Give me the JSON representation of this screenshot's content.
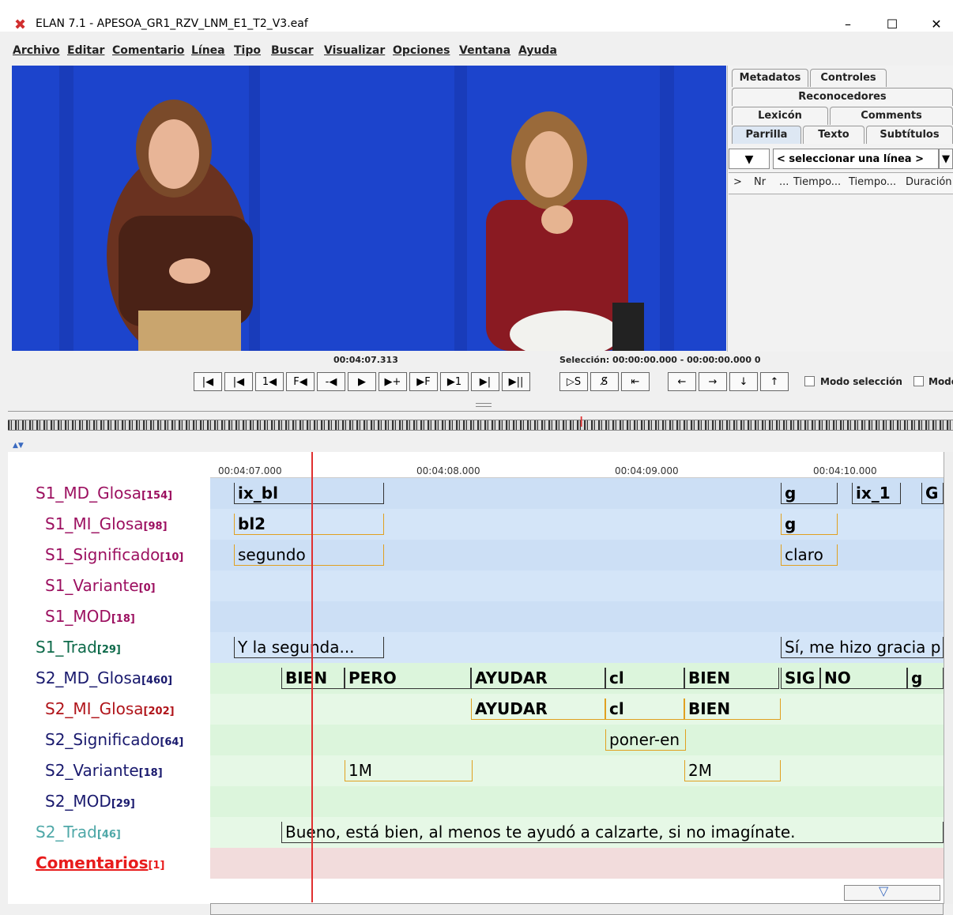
{
  "window": {
    "title": "ELAN 7.1 - APESOA_GR1_RZV_LNM_E1_T2_V3.eaf",
    "icon": "elan-logo-icon",
    "controls": [
      "–",
      "☐",
      "✕"
    ]
  },
  "menu": [
    "Archivo",
    "Editar",
    "Comentario",
    "Línea",
    "Tipo",
    "Buscar",
    "Visualizar",
    "Opciones",
    "Ventana",
    "Ayuda"
  ],
  "right_panel": {
    "tabs_row1": [
      "Metadatos",
      "Controles"
    ],
    "tabs_row2": [
      "Reconocedores"
    ],
    "tabs_row3": [
      "Lexicón",
      "Comments"
    ],
    "tabs_row4": [
      "Parrilla",
      "Texto",
      "Subtítulos"
    ],
    "selected_tab": "Parrilla",
    "tier_select_placeholder": "< seleccionar una línea >",
    "grid_columns": [
      ">",
      "Nr",
      "...",
      "Tiempo...",
      "Tiempo...",
      "Duración"
    ]
  },
  "player": {
    "current_time": "00:04:07.313",
    "selection": "Selección: 00:00:00.000 - 00:00:00.000  0",
    "buttons": [
      "|◀",
      "|◀",
      "1◀",
      "F◀",
      "-◀",
      "▶",
      "▶+",
      "▶F",
      "▶1",
      "▶|",
      "▶||"
    ],
    "sel_buttons": [
      "▷S",
      "S̸",
      "⇤"
    ],
    "nav_buttons": [
      "←",
      "→",
      "↓",
      "↑"
    ],
    "mode_selection_label": "Modo selección",
    "mode_other_label": "Modo"
  },
  "timeline": {
    "ruler_labels": [
      "00:04:07.000",
      "00:04:08.000",
      "00:04:09.000",
      "00:04:10.000"
    ],
    "tiers": [
      {
        "name": "S1_MD_Glosa",
        "count": "[154]",
        "color": "#9c1060"
      },
      {
        "name": "S1_MI_Glosa",
        "count": "[98]",
        "color": "#9c1060"
      },
      {
        "name": "S1_Significado",
        "count": "[10]",
        "color": "#9c1060"
      },
      {
        "name": "S1_Variante",
        "count": "[0]",
        "color": "#9c1060"
      },
      {
        "name": "S1_MOD",
        "count": "[18]",
        "color": "#9c1060"
      },
      {
        "name": "S1_Trad",
        "count": "[29]",
        "color": "#0e6a4a"
      },
      {
        "name": "S2_MD_Glosa",
        "count": "[460]",
        "color": "#1a1a6e"
      },
      {
        "name": "S2_MI_Glosa",
        "count": "[202]",
        "color": "#b0141a"
      },
      {
        "name": "S2_Significado",
        "count": "[64]",
        "color": "#1a1a6e"
      },
      {
        "name": "S2_Variante",
        "count": "[18]",
        "color": "#1a1a6e"
      },
      {
        "name": "S2_MOD",
        "count": "[29]",
        "color": "#1a1a6e"
      },
      {
        "name": "S2_Trad",
        "count": "[46]",
        "color": "#4fa8a8"
      },
      {
        "name": "Comentarios",
        "count": "[1]",
        "color": "#e81c1c"
      }
    ],
    "annotations": {
      "s1_md": [
        "ix_bl",
        "g",
        "ix_1",
        "G"
      ],
      "s1_mi": [
        "bl2",
        "g"
      ],
      "s1_sig": [
        "segundo",
        "claro"
      ],
      "s1_trad": [
        "Y la segunda...",
        "Sí, me hizo gracia p"
      ],
      "s2_md": [
        "BIEN",
        "PERO",
        "AYUDAR",
        "cl",
        "BIEN",
        "SIG",
        "NO",
        "g"
      ],
      "s2_mi": [
        "AYUDAR",
        "cl",
        "BIEN"
      ],
      "s2_sig": [
        "poner-en"
      ],
      "s2_var": [
        "1M",
        "2M"
      ],
      "s2_trad": [
        "Bueno, está bien, al menos te ayudó a calzarte, si no imagínate."
      ]
    }
  }
}
